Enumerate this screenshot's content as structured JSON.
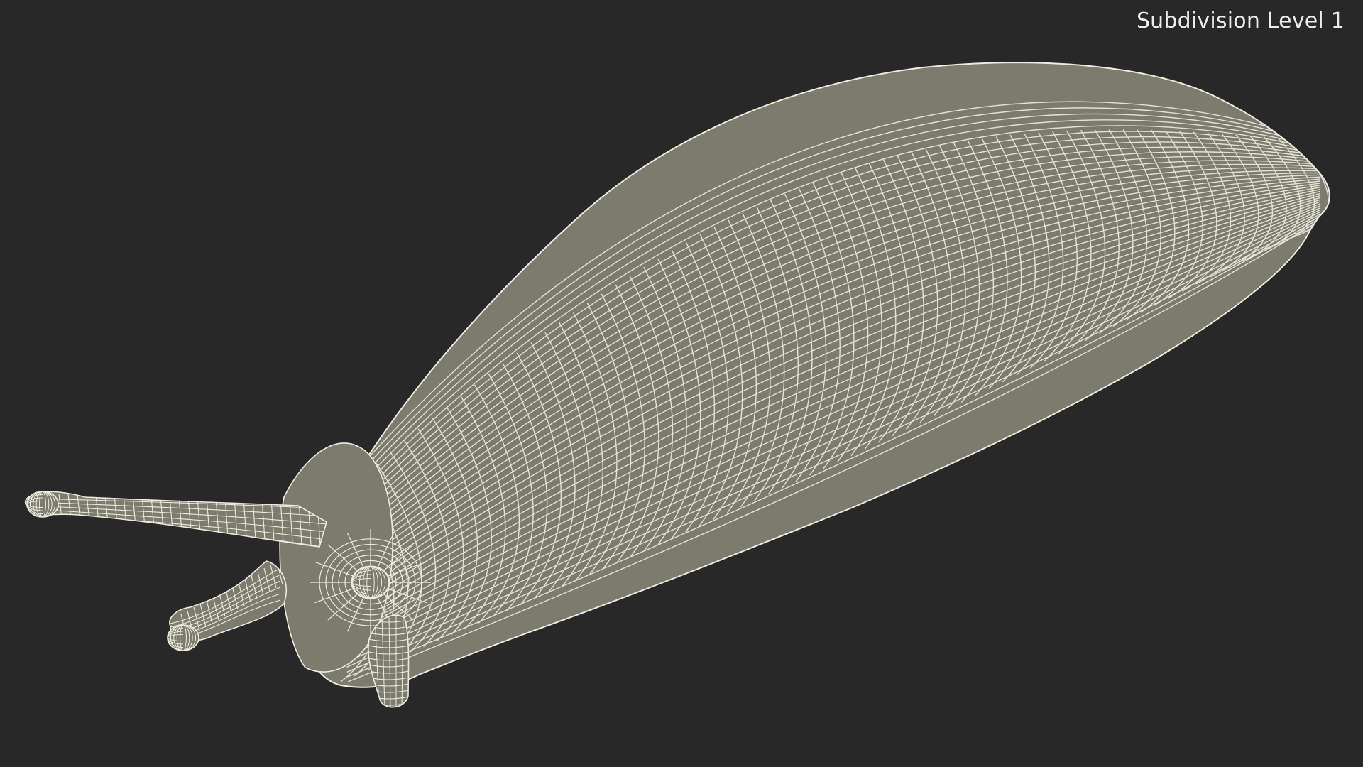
{
  "overlay": {
    "subdivision_label": "Subdivision Level 1"
  },
  "scene": {
    "subject": "slug wireframe mesh",
    "background_color": "#282828",
    "surface_color": "#7b7b6e",
    "wire_color": "#ecebe0"
  }
}
